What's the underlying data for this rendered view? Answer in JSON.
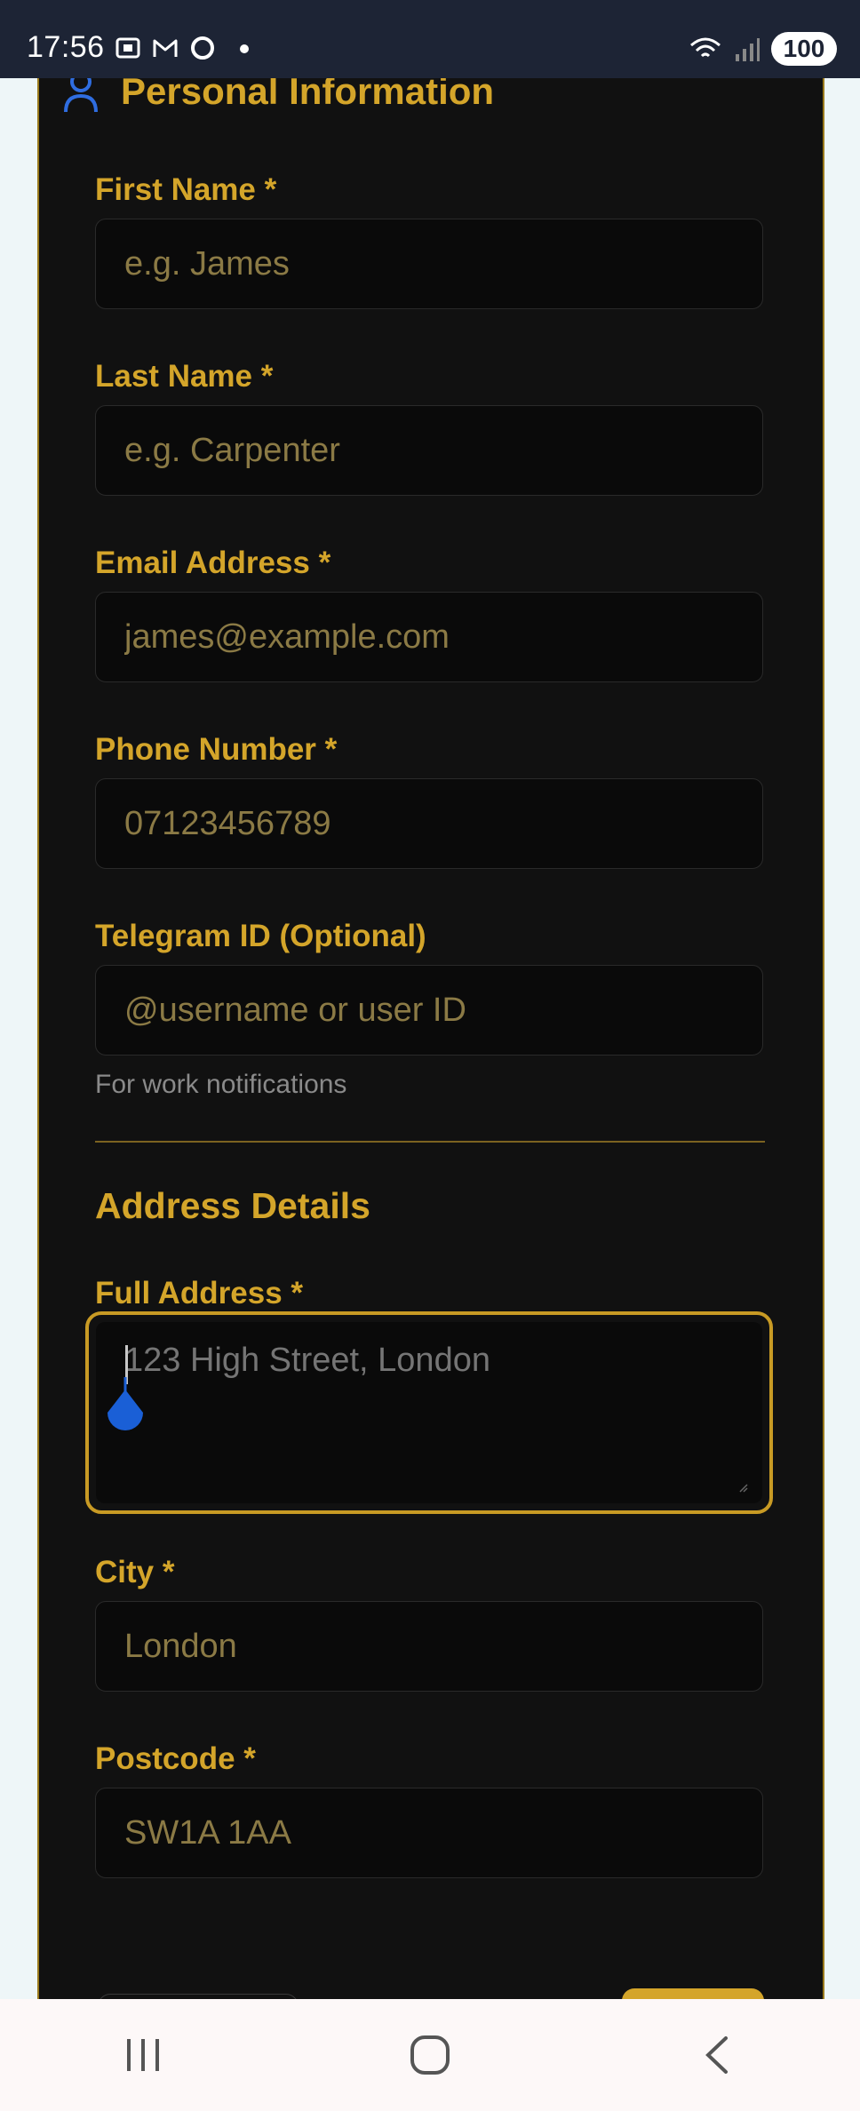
{
  "status_bar": {
    "time": "17:56",
    "battery": "100",
    "icons": [
      "screenshot-icon",
      "gmail-icon",
      "sync-icon",
      "wifi-icon",
      "signal-icon"
    ]
  },
  "form": {
    "section_title": "Personal Information",
    "fields": {
      "first_name": {
        "label": "First Name *",
        "placeholder": "e.g. James",
        "value": ""
      },
      "last_name": {
        "label": "Last Name *",
        "placeholder": "e.g. Carpenter",
        "value": ""
      },
      "email": {
        "label": "Email Address *",
        "placeholder": "james@example.com",
        "value": ""
      },
      "phone": {
        "label": "Phone Number *",
        "placeholder": "07123456789",
        "value": ""
      },
      "telegram": {
        "label": "Telegram ID (Optional)",
        "placeholder": "@username or user ID",
        "value": "",
        "helper": "For work notifications"
      }
    },
    "address_section_title": "Address Details",
    "address_fields": {
      "full_address": {
        "label": "Full Address *",
        "placeholder": "123 High Street, London",
        "value": "",
        "focused": true
      },
      "city": {
        "label": "City *",
        "placeholder": "London",
        "value": ""
      },
      "postcode": {
        "label": "Postcode *",
        "placeholder": "SW1A 1AA",
        "value": ""
      }
    }
  },
  "colors": {
    "accent": "#d4a52a",
    "card_bg": "#111111",
    "input_bg": "#0a0a0a",
    "placeholder": "#8b7a45",
    "helper_text": "#8a8a8a",
    "status_bar_bg": "#1d2435",
    "user_icon": "#2f6de0",
    "text_handle": "#1a5fd6"
  },
  "nav_bar": {
    "buttons": [
      "recent-apps-icon",
      "home-icon",
      "back-icon"
    ]
  }
}
